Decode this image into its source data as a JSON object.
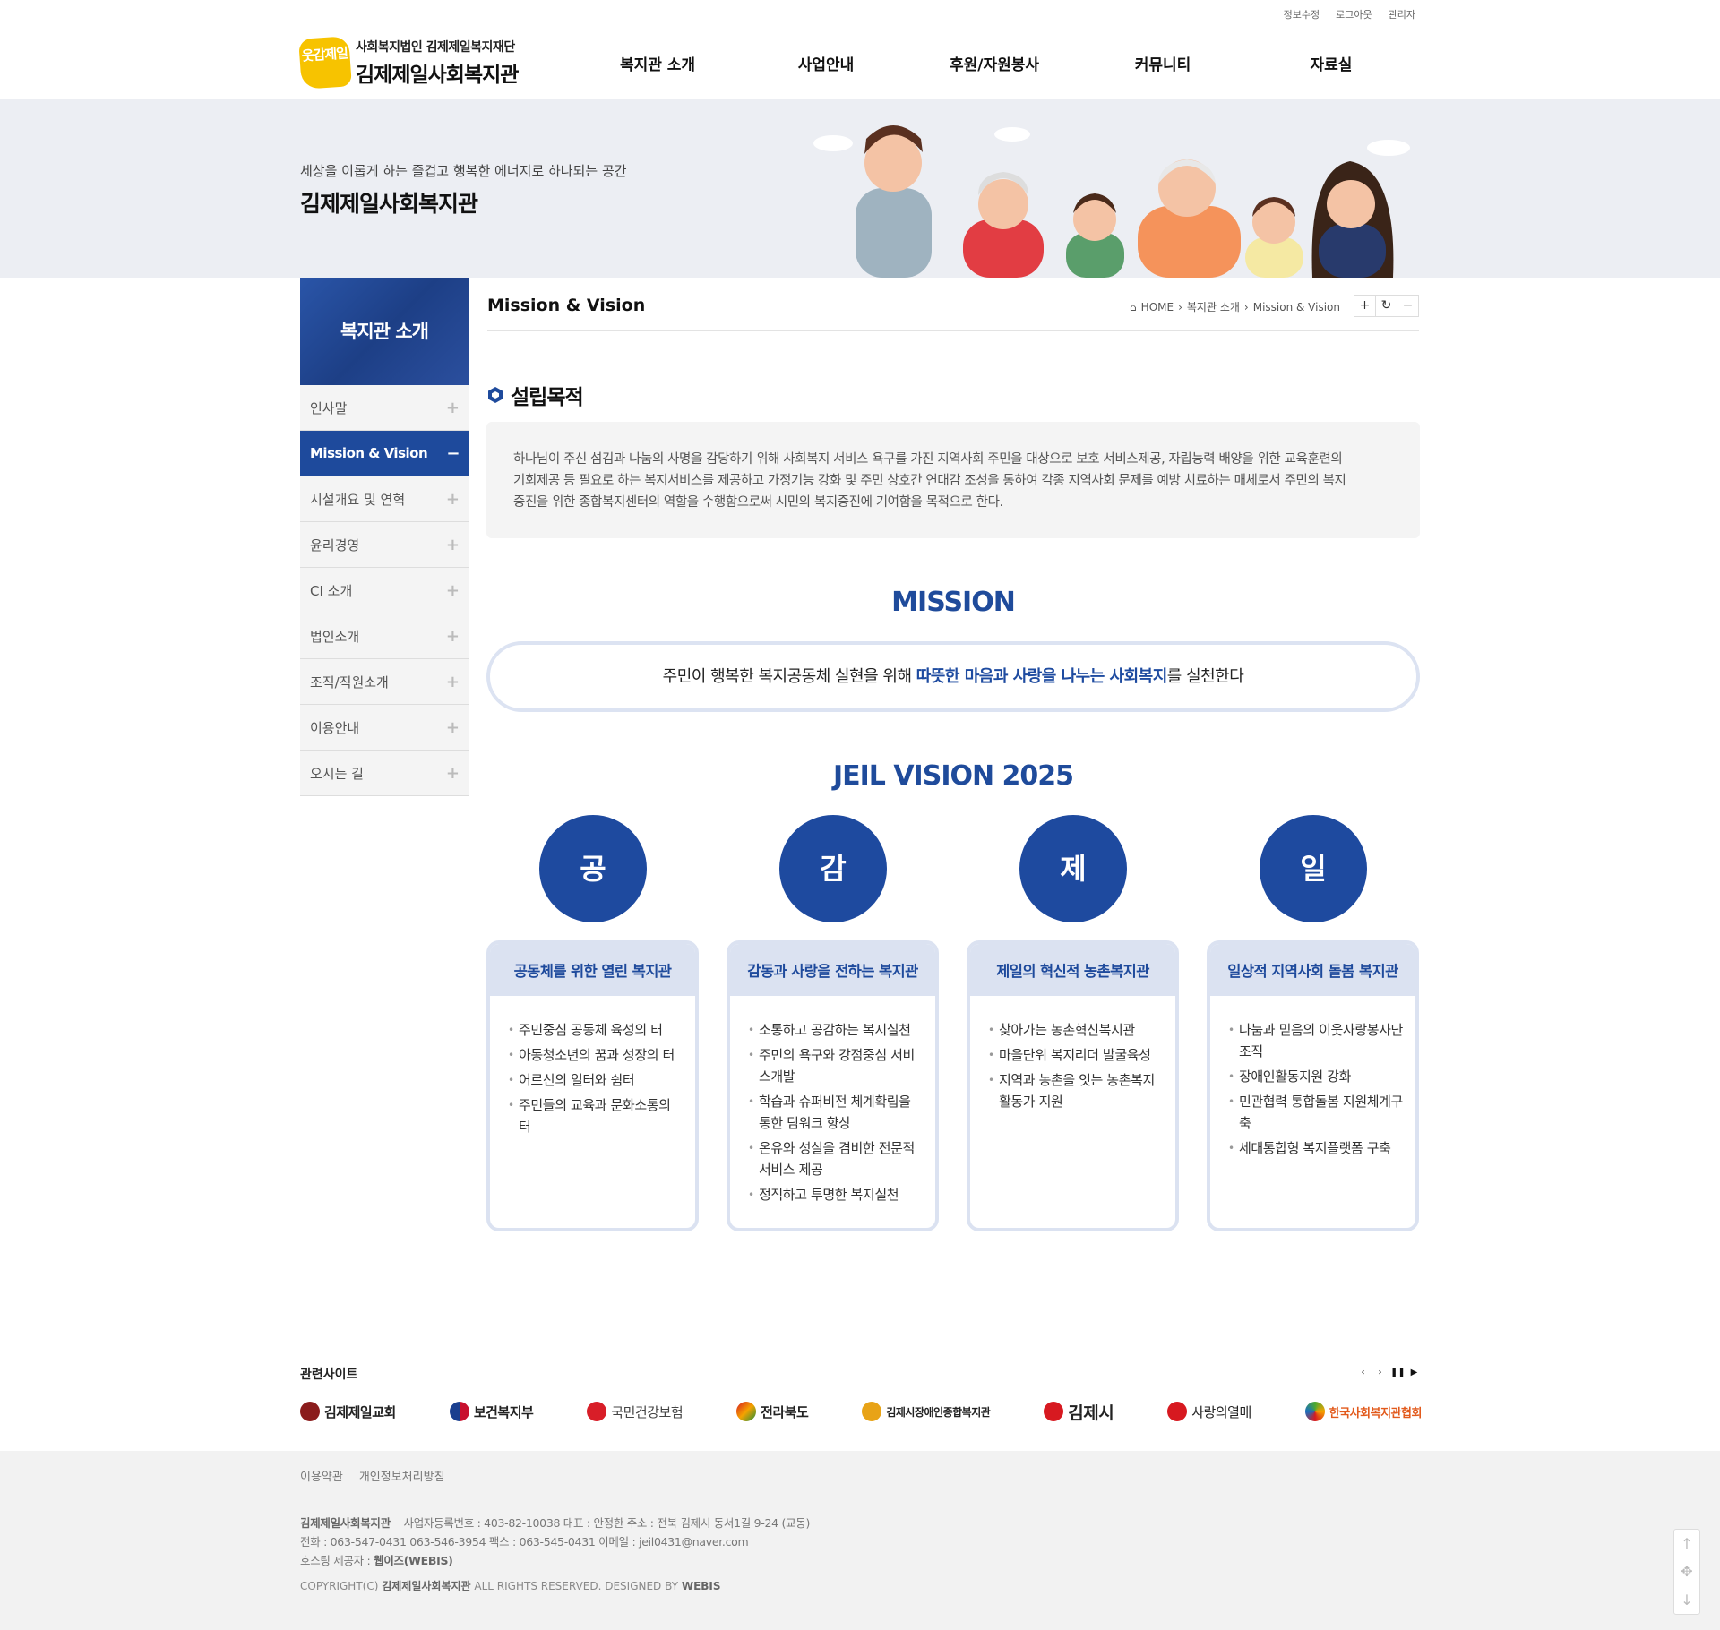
{
  "util_links": [
    "정보수정",
    "로그아웃",
    "관리자"
  ],
  "logo": {
    "mark": "웃감제일",
    "line1": "사회복지법인 김제제일복지재단",
    "line2": "김제제일사회복지관"
  },
  "gnb": [
    "복지관 소개",
    "사업안내",
    "후원/자원봉사",
    "커뮤니티",
    "자료실"
  ],
  "visual": {
    "subtitle": "세상을 이롭게 하는 즐겁고 행복한 에너지로 하나되는 공간",
    "title": "김제제일사회복지관"
  },
  "side": {
    "title": "복지관 소개",
    "items": [
      {
        "label": "인사말",
        "active": false
      },
      {
        "label": "Mission & Vision",
        "active": true
      },
      {
        "label": "시설개요 및 연혁",
        "active": false
      },
      {
        "label": "윤리경영",
        "active": false
      },
      {
        "label": "CI 소개",
        "active": false
      },
      {
        "label": "법인소개",
        "active": false
      },
      {
        "label": "조직/직원소개",
        "active": false
      },
      {
        "label": "이용안내",
        "active": false
      },
      {
        "label": "오시는 길",
        "active": false
      }
    ]
  },
  "content": {
    "title": "Mission & Vision",
    "breadcrumb": [
      "HOME",
      "복지관 소개",
      "Mission & Vision"
    ],
    "tools": [
      "+",
      "↻",
      "−"
    ],
    "purpose_heading": "설립목적",
    "purpose_lines": [
      "하나님이 주신 섬김과 나눔의 사명을 감당하기 위해 사회복지 서비스 욕구를 가진 지역사회 주민을 대상으로 보호 서비스제공, 자립능력 배양을 위한 교육훈련의",
      "기회제공 등 필요로 하는 복지서비스를 제공하고 가정기능 강화 및 주민 상호간 연대감 조성을 통하여 각종 지역사회 문제를 예방 치료하는 매체로서 주민의 복지",
      "증진을 위한 종합복지센터의 역할을 수행함으로써 시민의 복지증진에 기여함을 목적으로 한다."
    ],
    "mission_heading": "MISSION",
    "mission": {
      "pre": "주민이 행복한 복지공동체 실현을 위해 ",
      "highlight": "따뜻한 마음과 사랑을 나누는 사회복지",
      "post": "를 실천한다"
    },
    "vision_heading": "JEIL VISION 2025",
    "vision": [
      {
        "char": "공",
        "title": "공동체를 위한 열린 복지관",
        "items": [
          "주민중심 공동체 육성의 터",
          "아동청소년의 꿈과 성장의 터",
          "어르신의 일터와 쉼터",
          "주민들의 교육과 문화소통의 터"
        ]
      },
      {
        "char": "감",
        "title": "감동과 사랑을 전하는 복지관",
        "items": [
          "소통하고 공감하는 복지실천",
          "주민의 욕구와 강점중심 서비스개발",
          "학습과 슈퍼비전 체계확립을 통한 팀워크 향상",
          "온유와 성실을 겸비한 전문적 서비스 제공",
          "정직하고 투명한 복지실천"
        ]
      },
      {
        "char": "제",
        "title": "제일의 혁신적 농촌복지관",
        "items": [
          "찾아가는 농촌혁신복지관",
          "마을단위 복지리더 발굴육성",
          "지역과 농촌을 잇는 농촌복지활동가 지원"
        ]
      },
      {
        "char": "일",
        "title": "일상적 지역사회 돌봄 복지관",
        "items": [
          "나눔과 믿음의 이웃사랑봉사단 조직",
          "장애인활동지원 강화",
          "민관협력 통합돌봄 지원체계구축",
          "세대통합형 복지플랫폼 구축"
        ]
      }
    ]
  },
  "related": {
    "heading": "관련사이트",
    "controls": [
      "‹",
      "›",
      "❚❚",
      "▶"
    ],
    "sites": [
      {
        "name": "김제제일교회",
        "color": "#8b1c1c"
      },
      {
        "name": "보건복지부",
        "color": "#1b3f8f"
      },
      {
        "name": "국민건강보험",
        "color": "#d81e28"
      },
      {
        "name": "전라북도",
        "color": "#1f8d3a"
      },
      {
        "name": "김제시장애인종합복지관",
        "color": "#e8a317"
      },
      {
        "name": "김제시",
        "color": "#d71920"
      },
      {
        "name": "사랑의열매",
        "color": "#d71920"
      },
      {
        "name": "한국사회복지관협회",
        "color": "#4aa832"
      }
    ]
  },
  "footer": {
    "links": [
      "이용약관",
      "개인정보처리방침"
    ],
    "org": "김제제일사회복지관",
    "line1": "사업자등록번호 : 403-82-10038   대표 : 안정한   주소 : 전북 김제시 동서1길 9-24 (교동)",
    "line2": "전화 : 063-547-0431 063-546-3954   팩스 : 063-545-0431   이메일 : jeil0431@naver.com",
    "hosting_label": "호스팅 제공자 : ",
    "hosting": "웹이즈(WEBIS)",
    "copy_pre": "COPYRIGHT(C) ",
    "copy_org": "김제제일사회복지관",
    "copy_mid": " ALL RIGHTS RESERVED. DESIGNED BY ",
    "copy_by": "WEBIS"
  },
  "icons": {
    "home": "home-icon",
    "hex": "hexagon-icon",
    "quick_up": "arrow-up-icon",
    "quick_move": "move-icon",
    "quick_down": "arrow-down-icon"
  },
  "colors": {
    "primary": "#1e4a9c",
    "card_border": "#dbe2f1",
    "visual_bg": "#eceef3",
    "logo_yellow": "#f7c300"
  }
}
